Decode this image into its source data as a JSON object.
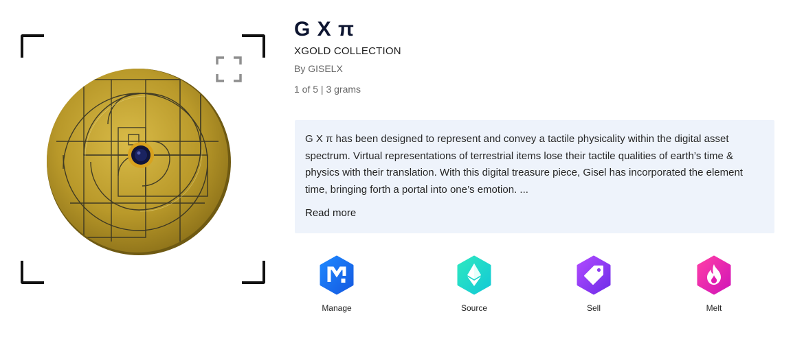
{
  "nft": {
    "title": "G X π",
    "collection": "XGOLD COLLECTION",
    "author": "By GISELX",
    "edition": "1 of 5 | 3 grams"
  },
  "description": {
    "text": "G X π has been designed to represent and convey a tactile physicality within the digital asset spectrum. Virtual representations of terrestrial items lose their tactile qualities of earth’s time & physics with their translation. With this digital treasure piece, Gisel has incorporated the element time, bringing forth a portal into one’s emotion. ...",
    "read_more": "Read more"
  },
  "actions": [
    {
      "label": "Manage",
      "icon": "manage-icon",
      "colors": [
        "#1e88ff",
        "#1559e0"
      ]
    },
    {
      "label": "Source",
      "icon": "ethereum-icon",
      "colors": [
        "#2ee8c0",
        "#12c9d6"
      ]
    },
    {
      "label": "Sell",
      "icon": "tag-icon",
      "colors": [
        "#b04bff",
        "#6e2ce8"
      ]
    },
    {
      "label": "Melt",
      "icon": "flame-icon",
      "colors": [
        "#ff3fa6",
        "#d014b8"
      ]
    }
  ],
  "colors": {
    "title": "#0d1530",
    "description_bg": "#eef3fb",
    "coin_gold": "#c9a62c"
  }
}
